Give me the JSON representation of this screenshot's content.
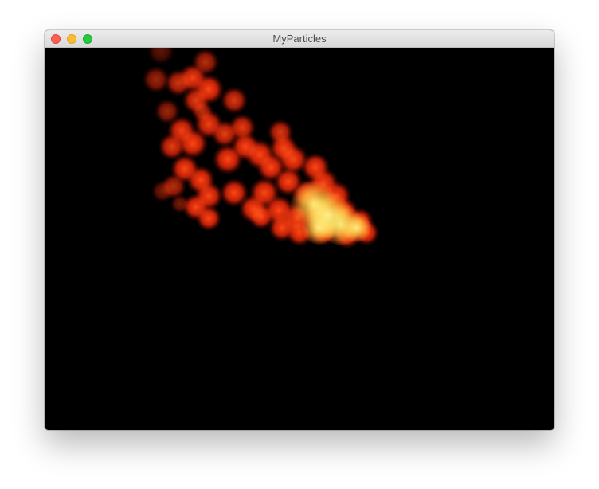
{
  "window": {
    "title": "MyParticles",
    "buttons": [
      "close",
      "minimize",
      "zoom"
    ]
  },
  "colors": {
    "canvas_background": "#000000",
    "particle_core": "#ff3a14",
    "particle_hot": "#ffd94a"
  }
}
